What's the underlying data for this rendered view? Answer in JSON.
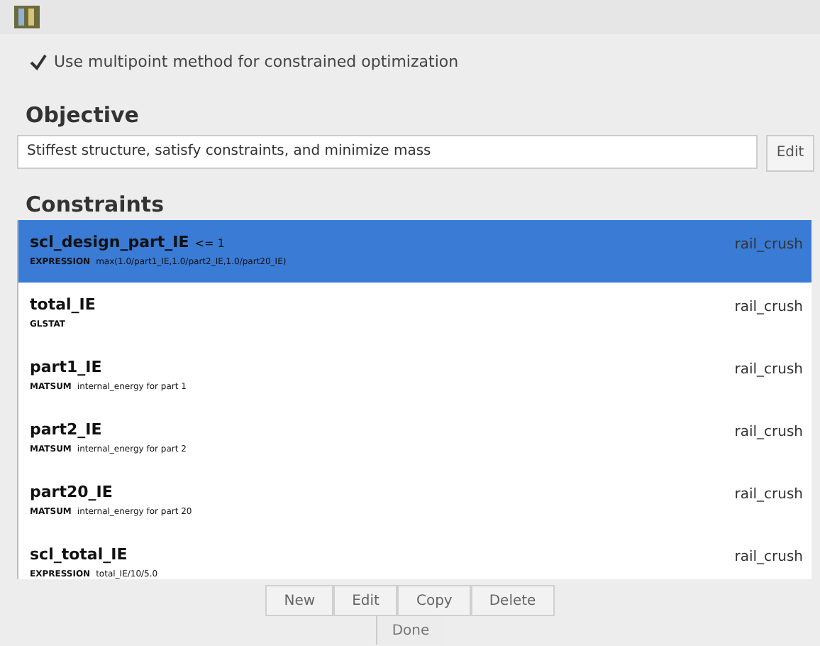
{
  "options": {
    "label": "Use multipoint method for constrained optimization",
    "checked": true
  },
  "objective": {
    "heading": "Objective",
    "value": "Stiffest structure, satisfy constraints, and minimize mass",
    "button": "Edit"
  },
  "constraints": {
    "heading": "Constraints",
    "rows": [
      {
        "name": "scl_design_part_IE",
        "condition": "<= 1",
        "type": "EXPRESSION",
        "detail": "max(1.0/part1_IE,1.0/part2_IE,1.0/part20_IE)",
        "loadcase": "rail_crush",
        "selected": true
      },
      {
        "name": "total_IE",
        "type": "GLSTAT",
        "detail": "",
        "loadcase": "rail_crush",
        "selected": false
      },
      {
        "name": "part1_IE",
        "type": "MATSUM",
        "detail": "internal_energy for part 1",
        "loadcase": "rail_crush",
        "selected": false
      },
      {
        "name": "part2_IE",
        "type": "MATSUM",
        "detail": "internal_energy for part 2",
        "loadcase": "rail_crush",
        "selected": false
      },
      {
        "name": "part20_IE",
        "type": "MATSUM",
        "detail": "internal_energy for part 20",
        "loadcase": "rail_crush",
        "selected": false
      },
      {
        "name": "scl_total_IE",
        "type": "EXPRESSION",
        "detail": "total_IE/10/5.0",
        "loadcase": "rail_crush",
        "selected": false
      }
    ]
  },
  "buttons": [
    "New",
    "Edit",
    "Copy",
    "Delete"
  ],
  "done": "Done"
}
